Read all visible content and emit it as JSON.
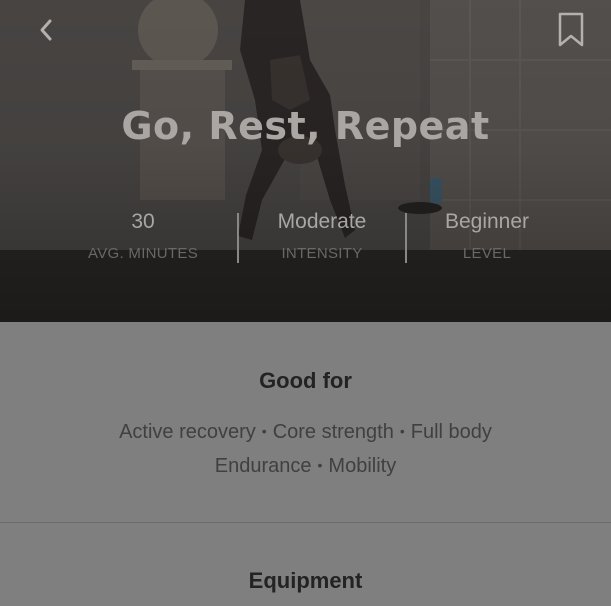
{
  "header": {
    "back_icon": "chevron-left-icon",
    "bookmark_icon": "bookmark-icon",
    "title": "Go, Rest, Repeat"
  },
  "stats": [
    {
      "value": "30",
      "label": "AVG. MINUTES"
    },
    {
      "value": "Moderate",
      "label": "INTENSITY"
    },
    {
      "value": "Beginner",
      "label": "LEVEL"
    }
  ],
  "good_for": {
    "heading": "Good for",
    "tags": [
      "Active recovery",
      "Core strength",
      "Full body",
      "Endurance",
      "Mobility"
    ],
    "separator": "•"
  },
  "equipment": {
    "heading": "Equipment"
  },
  "colors": {
    "content_background": "#7f7f7f",
    "title_text": "#a9a6a4",
    "heading_text": "#232323",
    "tag_text": "#404040"
  }
}
